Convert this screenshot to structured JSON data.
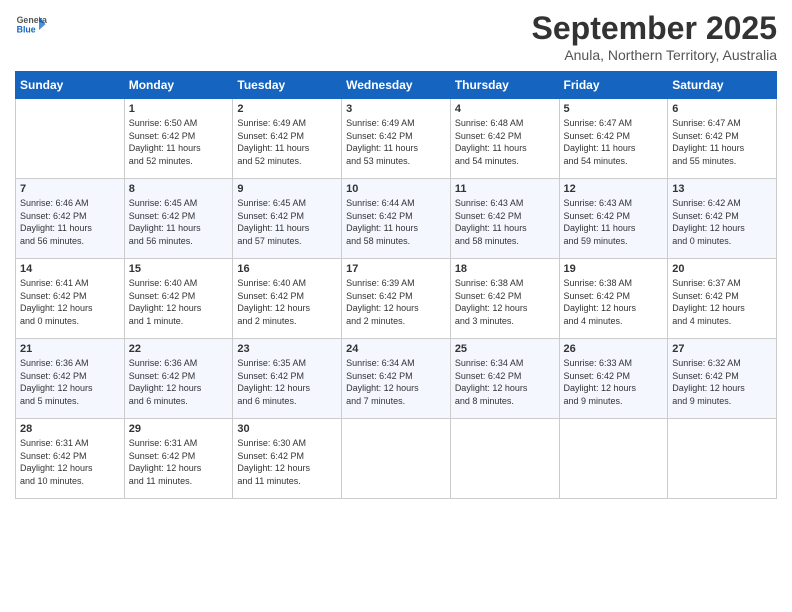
{
  "header": {
    "logo_general": "General",
    "logo_blue": "Blue",
    "month_title": "September 2025",
    "subtitle": "Anula, Northern Territory, Australia"
  },
  "days_of_week": [
    "Sunday",
    "Monday",
    "Tuesday",
    "Wednesday",
    "Thursday",
    "Friday",
    "Saturday"
  ],
  "weeks": [
    [
      {
        "day": "",
        "info": ""
      },
      {
        "day": "1",
        "info": "Sunrise: 6:50 AM\nSunset: 6:42 PM\nDaylight: 11 hours\nand 52 minutes."
      },
      {
        "day": "2",
        "info": "Sunrise: 6:49 AM\nSunset: 6:42 PM\nDaylight: 11 hours\nand 52 minutes."
      },
      {
        "day": "3",
        "info": "Sunrise: 6:49 AM\nSunset: 6:42 PM\nDaylight: 11 hours\nand 53 minutes."
      },
      {
        "day": "4",
        "info": "Sunrise: 6:48 AM\nSunset: 6:42 PM\nDaylight: 11 hours\nand 54 minutes."
      },
      {
        "day": "5",
        "info": "Sunrise: 6:47 AM\nSunset: 6:42 PM\nDaylight: 11 hours\nand 54 minutes."
      },
      {
        "day": "6",
        "info": "Sunrise: 6:47 AM\nSunset: 6:42 PM\nDaylight: 11 hours\nand 55 minutes."
      }
    ],
    [
      {
        "day": "7",
        "info": "Sunrise: 6:46 AM\nSunset: 6:42 PM\nDaylight: 11 hours\nand 56 minutes."
      },
      {
        "day": "8",
        "info": "Sunrise: 6:45 AM\nSunset: 6:42 PM\nDaylight: 11 hours\nand 56 minutes."
      },
      {
        "day": "9",
        "info": "Sunrise: 6:45 AM\nSunset: 6:42 PM\nDaylight: 11 hours\nand 57 minutes."
      },
      {
        "day": "10",
        "info": "Sunrise: 6:44 AM\nSunset: 6:42 PM\nDaylight: 11 hours\nand 58 minutes."
      },
      {
        "day": "11",
        "info": "Sunrise: 6:43 AM\nSunset: 6:42 PM\nDaylight: 11 hours\nand 58 minutes."
      },
      {
        "day": "12",
        "info": "Sunrise: 6:43 AM\nSunset: 6:42 PM\nDaylight: 11 hours\nand 59 minutes."
      },
      {
        "day": "13",
        "info": "Sunrise: 6:42 AM\nSunset: 6:42 PM\nDaylight: 12 hours\nand 0 minutes."
      }
    ],
    [
      {
        "day": "14",
        "info": "Sunrise: 6:41 AM\nSunset: 6:42 PM\nDaylight: 12 hours\nand 0 minutes."
      },
      {
        "day": "15",
        "info": "Sunrise: 6:40 AM\nSunset: 6:42 PM\nDaylight: 12 hours\nand 1 minute."
      },
      {
        "day": "16",
        "info": "Sunrise: 6:40 AM\nSunset: 6:42 PM\nDaylight: 12 hours\nand 2 minutes."
      },
      {
        "day": "17",
        "info": "Sunrise: 6:39 AM\nSunset: 6:42 PM\nDaylight: 12 hours\nand 2 minutes."
      },
      {
        "day": "18",
        "info": "Sunrise: 6:38 AM\nSunset: 6:42 PM\nDaylight: 12 hours\nand 3 minutes."
      },
      {
        "day": "19",
        "info": "Sunrise: 6:38 AM\nSunset: 6:42 PM\nDaylight: 12 hours\nand 4 minutes."
      },
      {
        "day": "20",
        "info": "Sunrise: 6:37 AM\nSunset: 6:42 PM\nDaylight: 12 hours\nand 4 minutes."
      }
    ],
    [
      {
        "day": "21",
        "info": "Sunrise: 6:36 AM\nSunset: 6:42 PM\nDaylight: 12 hours\nand 5 minutes."
      },
      {
        "day": "22",
        "info": "Sunrise: 6:36 AM\nSunset: 6:42 PM\nDaylight: 12 hours\nand 6 minutes."
      },
      {
        "day": "23",
        "info": "Sunrise: 6:35 AM\nSunset: 6:42 PM\nDaylight: 12 hours\nand 6 minutes."
      },
      {
        "day": "24",
        "info": "Sunrise: 6:34 AM\nSunset: 6:42 PM\nDaylight: 12 hours\nand 7 minutes."
      },
      {
        "day": "25",
        "info": "Sunrise: 6:34 AM\nSunset: 6:42 PM\nDaylight: 12 hours\nand 8 minutes."
      },
      {
        "day": "26",
        "info": "Sunrise: 6:33 AM\nSunset: 6:42 PM\nDaylight: 12 hours\nand 9 minutes."
      },
      {
        "day": "27",
        "info": "Sunrise: 6:32 AM\nSunset: 6:42 PM\nDaylight: 12 hours\nand 9 minutes."
      }
    ],
    [
      {
        "day": "28",
        "info": "Sunrise: 6:31 AM\nSunset: 6:42 PM\nDaylight: 12 hours\nand 10 minutes."
      },
      {
        "day": "29",
        "info": "Sunrise: 6:31 AM\nSunset: 6:42 PM\nDaylight: 12 hours\nand 11 minutes."
      },
      {
        "day": "30",
        "info": "Sunrise: 6:30 AM\nSunset: 6:42 PM\nDaylight: 12 hours\nand 11 minutes."
      },
      {
        "day": "",
        "info": ""
      },
      {
        "day": "",
        "info": ""
      },
      {
        "day": "",
        "info": ""
      },
      {
        "day": "",
        "info": ""
      }
    ]
  ]
}
